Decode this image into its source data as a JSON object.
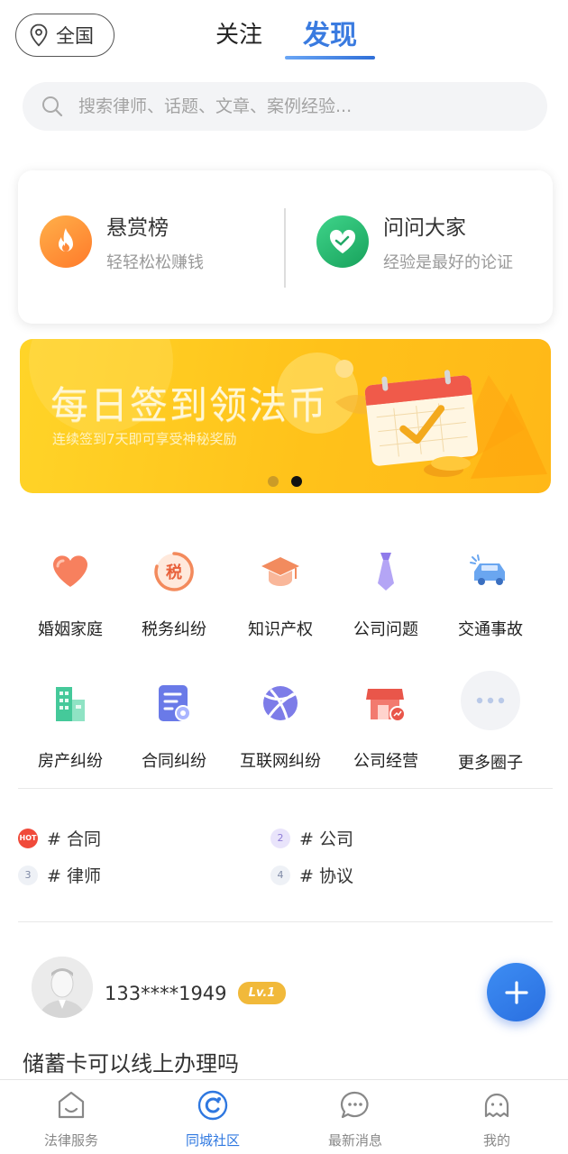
{
  "header": {
    "region": "全国",
    "tabs": [
      {
        "label": "关注",
        "active": false
      },
      {
        "label": "发现",
        "active": true
      }
    ]
  },
  "search": {
    "placeholder": "搜索律师、话题、文章、案例经验..."
  },
  "features": [
    {
      "title": "悬赏榜",
      "subtitle": "轻轻松松赚钱",
      "icon": "flame-icon"
    },
    {
      "title": "问问大家",
      "subtitle": "经验是最好的论证",
      "icon": "heart-hands-icon"
    }
  ],
  "banner": {
    "title": "每日签到领法币",
    "subtitle": "连续签到7天即可享受神秘奖励",
    "active_slide": 2,
    "slide_count": 2
  },
  "categories": [
    {
      "label": "婚姻家庭",
      "icon": "heart-icon"
    },
    {
      "label": "税务纠纷",
      "icon": "tax-icon",
      "glyph": "税"
    },
    {
      "label": "知识产权",
      "icon": "graduation-cap-icon"
    },
    {
      "label": "公司问题",
      "icon": "necktie-icon"
    },
    {
      "label": "交通事故",
      "icon": "car-crash-icon"
    },
    {
      "label": "房产纠纷",
      "icon": "building-icon"
    },
    {
      "label": "合同纠纷",
      "icon": "contract-icon"
    },
    {
      "label": "互联网纠纷",
      "icon": "globe-icon"
    },
    {
      "label": "公司经营",
      "icon": "storefront-icon"
    },
    {
      "label": "更多圈子",
      "icon": "more-icon"
    }
  ],
  "hot_topics": [
    {
      "rank": "HOT",
      "label": "# 合同"
    },
    {
      "rank": "2",
      "label": "# 公司"
    },
    {
      "rank": "3",
      "label": "# 律师"
    },
    {
      "rank": "4",
      "label": "# 协议"
    }
  ],
  "post": {
    "username": "133****1949",
    "level": "Lv.1",
    "title": "储蓄卡可以线上办理吗"
  },
  "bottom_nav": [
    {
      "label": "法律服务",
      "icon": "home-icon",
      "active": false
    },
    {
      "label": "同城社区",
      "icon": "community-icon",
      "active": true
    },
    {
      "label": "最新消息",
      "icon": "message-icon",
      "active": false
    },
    {
      "label": "我的",
      "icon": "profile-icon",
      "active": false
    }
  ],
  "colors": {
    "accent": "#3a7be0",
    "banner": "#ffc21a",
    "level_badge": "#f1b93a"
  }
}
